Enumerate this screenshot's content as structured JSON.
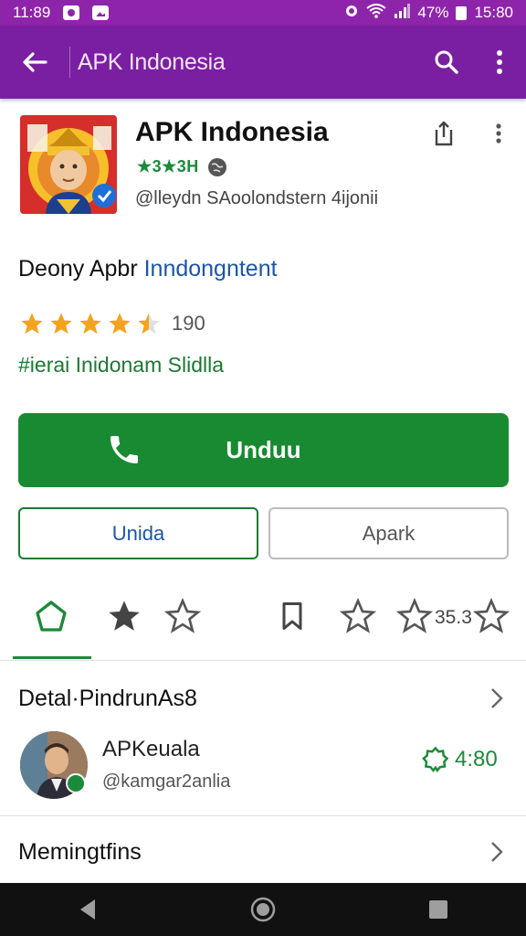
{
  "status_bar": {
    "time_left": "11:89",
    "battery_pct": "47%",
    "time_right": "15:80"
  },
  "app_bar": {
    "title": "APK Indonesia"
  },
  "app": {
    "name": "APK Indonesia",
    "rating_badge": "★3★3H",
    "developer": "@lleydn SAoolondstern 4ijonii"
  },
  "subtitle": {
    "part1": "Deony Apbr",
    "part2": "Inndongntent"
  },
  "rating": {
    "stars": 4.5,
    "count": "190"
  },
  "tagline": "#ierai Inidonam Slidlla",
  "buttons": {
    "install": "Unduu",
    "secondary_left": "Unida",
    "secondary_right": "Apark"
  },
  "tabs": {
    "count_label": "35.3"
  },
  "details": {
    "title": "Detal·PindrunAs8"
  },
  "review": {
    "name": "APKeuala",
    "handle": "@kamgar2anlia",
    "score": "4:80"
  },
  "meeting": {
    "title": "Memingtfins"
  },
  "colors": {
    "primary": "#7b1fa2",
    "accent_green": "#188a31",
    "link_blue": "#1a56a8"
  }
}
